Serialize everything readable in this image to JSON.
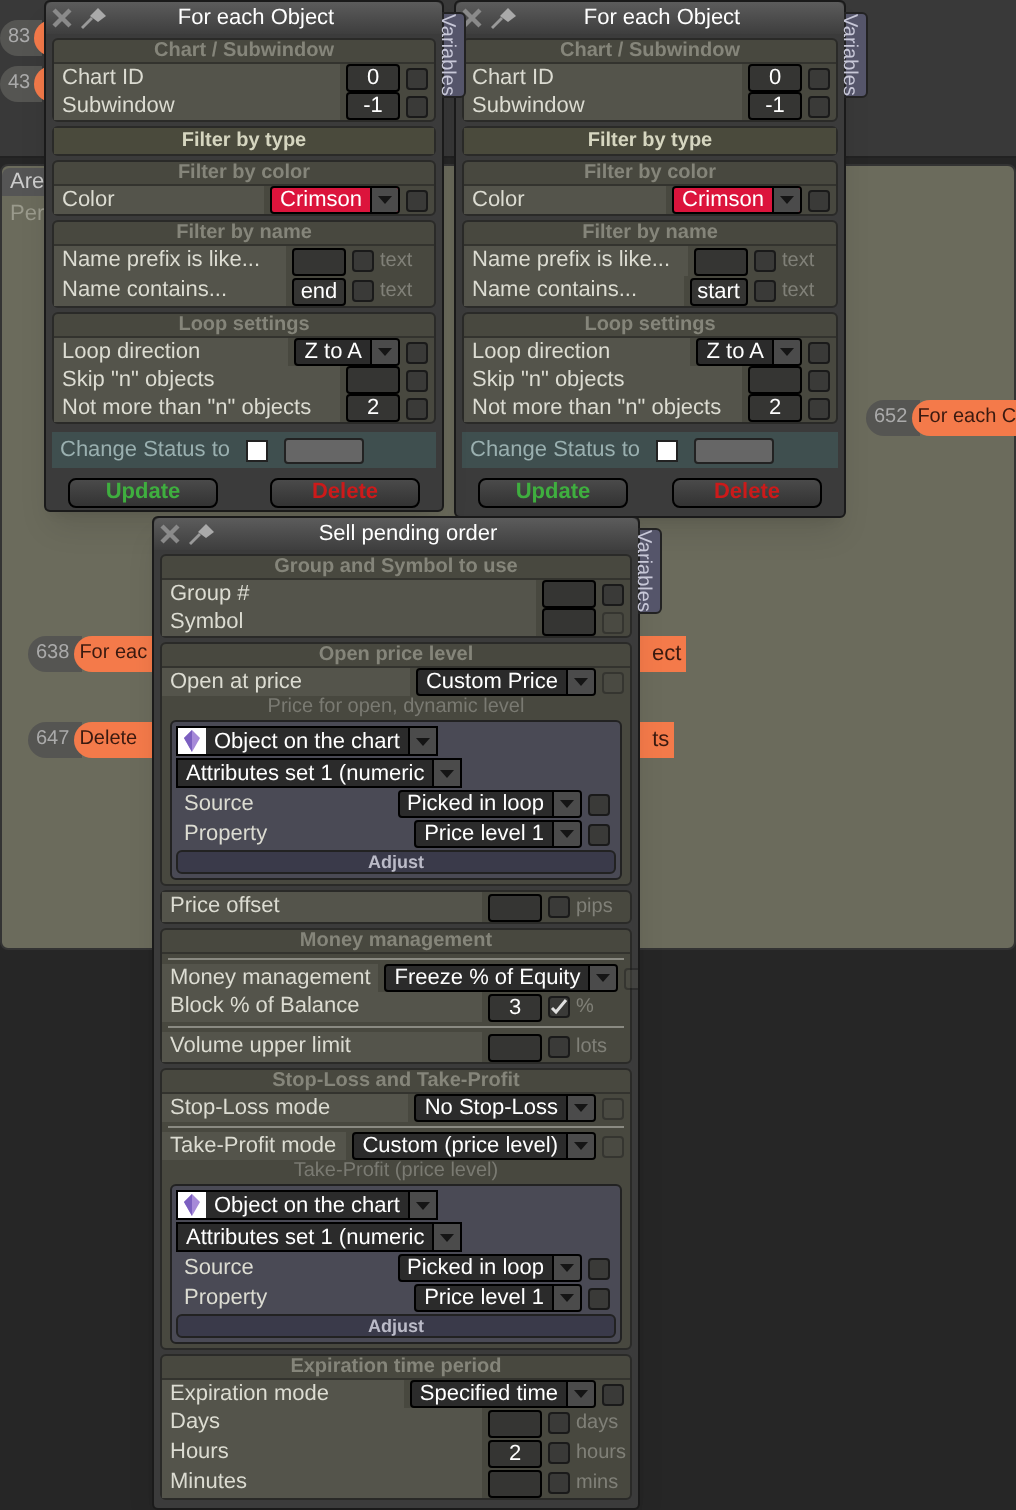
{
  "canvas": {
    "tab": "Are",
    "text": "Per"
  },
  "nodes": [
    {
      "number": "83"
    },
    {
      "number": "43"
    },
    {
      "number": "652",
      "label": "For each C"
    },
    {
      "number": "638",
      "label": "For eac",
      "tail": "ect"
    },
    {
      "number": "647",
      "label": "Delete",
      "tail": "ts"
    }
  ],
  "windows": [
    {
      "title": "For each Object",
      "side_tab": "Variables",
      "sections": [
        {
          "heading": "Chart / Subwindow",
          "expanded": true,
          "rows": [
            {
              "kind": "input",
              "label": "Chart ID",
              "value": "0",
              "checked": false,
              "disabled": false
            },
            {
              "kind": "input",
              "label": "Subwindow",
              "value": "-1",
              "checked": false,
              "disabled": false
            }
          ]
        },
        {
          "heading": "Filter by type",
          "expanded": false
        },
        {
          "heading": "Filter by color",
          "expanded": true,
          "rows": [
            {
              "kind": "color",
              "label": "Color",
              "value": "Crimson",
              "checked": false,
              "disabled": false
            }
          ]
        },
        {
          "heading": "Filter by name",
          "expanded": true,
          "rows": [
            {
              "kind": "input",
              "label": "Name prefix is like...",
              "checked": false,
              "disabled": false,
              "unit": "text"
            },
            {
              "kind": "input",
              "label": "Name contains...",
              "value": "end",
              "checked": false,
              "disabled": false,
              "unit": "text"
            }
          ]
        },
        {
          "heading": "Loop settings",
          "expanded": true,
          "rows": [
            {
              "kind": "select",
              "label": "Loop direction",
              "value": "Z to A",
              "checked": false,
              "disabled": false
            },
            {
              "kind": "input",
              "label": "Skip \"n\" objects",
              "checked": false,
              "disabled": false
            },
            {
              "kind": "input",
              "label": "Not more than \"n\" objects",
              "value": "2",
              "checked": false,
              "disabled": false
            }
          ]
        }
      ],
      "status": {
        "label": "Change Status to",
        "checked": false
      },
      "buttons": [
        {
          "label": "Update",
          "kind": "update"
        },
        {
          "label": "Delete",
          "kind": "delete"
        }
      ]
    },
    {
      "title": "For each Object",
      "side_tab": "Variables",
      "sections": [
        {
          "heading": "Chart / Subwindow",
          "expanded": true,
          "rows": [
            {
              "kind": "input",
              "label": "Chart ID",
              "value": "0",
              "checked": false,
              "disabled": false
            },
            {
              "kind": "input",
              "label": "Subwindow",
              "value": "-1",
              "checked": false,
              "disabled": false
            }
          ]
        },
        {
          "heading": "Filter by type",
          "expanded": false
        },
        {
          "heading": "Filter by color",
          "expanded": true,
          "rows": [
            {
              "kind": "color",
              "label": "Color",
              "value": "Crimson",
              "checked": false,
              "disabled": false
            }
          ]
        },
        {
          "heading": "Filter by name",
          "expanded": true,
          "rows": [
            {
              "kind": "input",
              "label": "Name prefix is like...",
              "checked": false,
              "disabled": false,
              "unit": "text"
            },
            {
              "kind": "input",
              "label": "Name contains...",
              "value": "start",
              "checked": false,
              "disabled": false,
              "unit": "text"
            }
          ]
        },
        {
          "heading": "Loop settings",
          "expanded": true,
          "rows": [
            {
              "kind": "select",
              "label": "Loop direction",
              "value": "Z to A",
              "checked": false,
              "disabled": false
            },
            {
              "kind": "input",
              "label": "Skip \"n\" objects",
              "checked": false,
              "disabled": false
            },
            {
              "kind": "input",
              "label": "Not more than \"n\" objects",
              "value": "2",
              "checked": false,
              "disabled": false
            }
          ]
        }
      ],
      "status": {
        "label": "Change Status to",
        "checked": false
      },
      "buttons": [
        {
          "label": "Update",
          "kind": "update"
        },
        {
          "label": "Delete",
          "kind": "delete"
        }
      ]
    },
    {
      "title": "Sell pending order",
      "side_tab": "Variables",
      "sections": [
        {
          "heading": "Group and Symbol to use",
          "expanded": true,
          "rows": [
            {
              "kind": "input",
              "label": "Group #",
              "checked": false,
              "disabled": false
            },
            {
              "kind": "input",
              "label": "Symbol",
              "checked": false,
              "disabled": true
            }
          ]
        },
        {
          "heading": "Open price level",
          "expanded": true,
          "rows": [
            {
              "kind": "select",
              "label": "Open at price",
              "value": "Custom Price",
              "checked": false,
              "disabled": true
            },
            {
              "kind": "caption",
              "text": "Price for open, dynamic level"
            },
            {
              "kind": "object_panel",
              "object": "Object on the chart",
              "attributes": "Attributes set 1 (numeric",
              "rows": [
                {
                  "kind": "select",
                  "label": "Source",
                  "value": "Picked in loop",
                  "checked": false,
                  "disabled": false
                },
                {
                  "kind": "select",
                  "label": "Property",
                  "value": "Price level 1",
                  "checked": false,
                  "disabled": false
                }
              ],
              "button": "Adjust"
            }
          ]
        },
        {
          "rows": [
            {
              "kind": "input",
              "label": "Price offset",
              "checked": false,
              "disabled": false,
              "unit": "pips"
            }
          ]
        },
        {
          "heading": "Money management",
          "expanded": true,
          "rows": [
            {
              "kind": "divider"
            },
            {
              "kind": "select",
              "label": "Money management",
              "value": "Freeze % of Equity",
              "checked": false,
              "disabled": true
            },
            {
              "kind": "input",
              "label": "Block % of Balance",
              "value": "3",
              "checked": true,
              "disabled": false,
              "unit": "%"
            },
            {
              "kind": "divider"
            },
            {
              "kind": "input",
              "label": "Volume upper limit",
              "checked": false,
              "disabled": false,
              "unit": "lots"
            }
          ]
        },
        {
          "heading": "Stop-Loss and Take-Profit",
          "expanded": true,
          "rows": [
            {
              "kind": "select",
              "label": "Stop-Loss mode",
              "value": "No Stop-Loss",
              "checked": false,
              "disabled": true
            },
            {
              "kind": "divider"
            },
            {
              "kind": "select",
              "label": "Take-Profit mode",
              "value": "Custom (price level)",
              "checked": false,
              "disabled": true
            },
            {
              "kind": "caption",
              "text": "Take-Profit (price level)"
            },
            {
              "kind": "object_panel",
              "object": "Object on the chart",
              "attributes": "Attributes set 1 (numeric",
              "rows": [
                {
                  "kind": "select",
                  "label": "Source",
                  "value": "Picked in loop",
                  "checked": false,
                  "disabled": false
                },
                {
                  "kind": "select",
                  "label": "Property",
                  "value": "Price level 1",
                  "checked": false,
                  "disabled": false
                }
              ],
              "button": "Adjust"
            }
          ]
        },
        {
          "heading": "Expiration time period",
          "expanded": true,
          "rows": [
            {
              "kind": "select",
              "label": "Expiration mode",
              "value": "Specified time",
              "checked": false,
              "disabled": false
            },
            {
              "kind": "input",
              "label": "Days",
              "checked": false,
              "disabled": false,
              "unit": "days"
            },
            {
              "kind": "input",
              "label": "Hours",
              "value": "2",
              "checked": false,
              "disabled": false,
              "unit": "hours"
            },
            {
              "kind": "input",
              "label": "Minutes",
              "checked": false,
              "disabled": false,
              "unit": "mins"
            }
          ]
        }
      ]
    }
  ]
}
